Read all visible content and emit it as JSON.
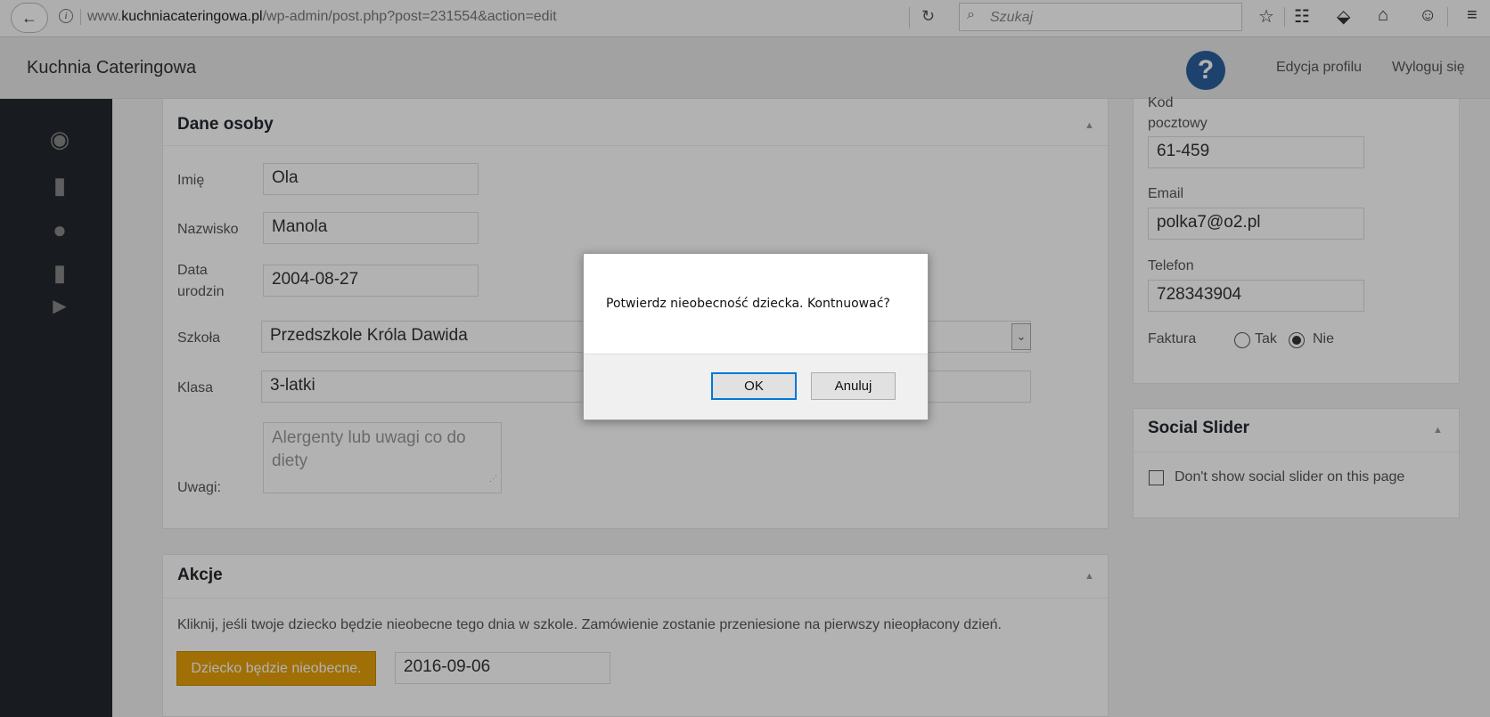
{
  "browser": {
    "url_prefix": "www.",
    "url_domain": "kuchniacateringowa.pl",
    "url_path": "/wp-admin/post.php?post=231554&action=edit",
    "search_placeholder": "Szukaj",
    "icons": [
      "back-icon",
      "info-icon",
      "reload-icon",
      "search-icon",
      "star-icon",
      "reader-icon",
      "pocket-icon",
      "home-icon",
      "chat-icon",
      "menu-icon"
    ]
  },
  "adminbar": {
    "site_name": "Kuchnia Cateringowa",
    "help_label": "?",
    "edit_profile": "Edycja profilu",
    "logout": "Wyloguj się"
  },
  "sidebar": {
    "icons": [
      "dashboard-icon",
      "page-icon",
      "user-icon",
      "page-icon",
      "play-icon"
    ]
  },
  "person_panel": {
    "title": "Dane osoby",
    "first_name_label": "Imię",
    "first_name": "Ola",
    "last_name_label": "Nazwisko",
    "last_name": "Manola",
    "birth_label_1": "Data",
    "birth_label_2": "urodzin",
    "birth_date": "2004-08-27",
    "school_label": "Szkoła",
    "school": "Przedszkole Króla Dawida",
    "class_label": "Klasa",
    "class": "3-latki",
    "notes_label": "Uwagi:",
    "notes_placeholder": "Alergenty lub uwagi co do diety"
  },
  "contact_panel": {
    "postal_label_1": "Kod",
    "postal_label_2": "pocztowy",
    "postal_code": "61-459",
    "email_label": "Email",
    "email": "polka7@o2.pl",
    "phone_label": "Telefon",
    "phone": "728343904",
    "invoice_label": "Faktura",
    "invoice_yes": "Tak",
    "invoice_no": "Nie",
    "invoice_selected": "Nie"
  },
  "social_panel": {
    "title": "Social Slider",
    "checkbox_label": "Don't show social slider on this page"
  },
  "actions_panel": {
    "title": "Akcje",
    "description": "Kliknij, jeśli twoje dziecko będzie nieobecne tego dnia w szkole. Zamówienie zostanie przeniesione na pierwszy nieopłacony dzień.",
    "button_label": "Dziecko będzie nieobecne.",
    "date": "2016-09-06"
  },
  "dialog": {
    "message": "Potwierdz nieobecność dziecka. Kontnuować?",
    "ok_label": "OK",
    "cancel_label": "Anuluj"
  }
}
